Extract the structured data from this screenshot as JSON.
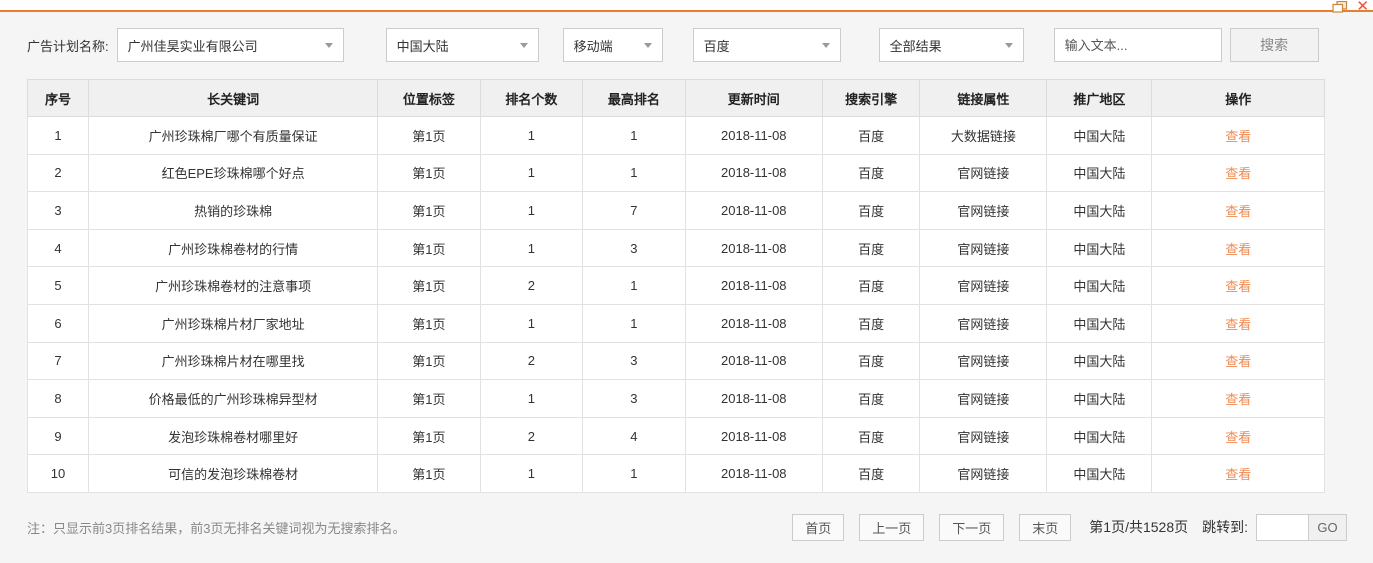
{
  "window": {
    "restore_icon": "restore-window",
    "close_icon": "✕"
  },
  "filters": {
    "label": "广告计划名称:",
    "plan_dropdown": "广州佳昊实业有限公司",
    "region_dropdown": "中国大陆",
    "device_dropdown": "移动端",
    "engine_dropdown": "百度",
    "result_dropdown": "全部结果",
    "search_placeholder": "输入文本...",
    "search_button": "搜索"
  },
  "table": {
    "columns": [
      "序号",
      "长关键词",
      "位置标签",
      "排名个数",
      "最高排名",
      "更新时间",
      "搜索引擎",
      "链接属性",
      "推广地区",
      "操作"
    ],
    "rows": [
      {
        "seq": "1",
        "keyword": "广州珍珠棉厂哪个有质量保证",
        "tag": "第1页",
        "count": "1",
        "best": "1",
        "updated": "2018-11-08",
        "engine": "百度",
        "link_type": "大数据链接",
        "region": "中国大陆",
        "action": "查看"
      },
      {
        "seq": "2",
        "keyword": "红色EPE珍珠棉哪个好点",
        "tag": "第1页",
        "count": "1",
        "best": "1",
        "updated": "2018-11-08",
        "engine": "百度",
        "link_type": "官网链接",
        "region": "中国大陆",
        "action": "查看"
      },
      {
        "seq": "3",
        "keyword": "热销的珍珠棉",
        "tag": "第1页",
        "count": "1",
        "best": "7",
        "updated": "2018-11-08",
        "engine": "百度",
        "link_type": "官网链接",
        "region": "中国大陆",
        "action": "查看"
      },
      {
        "seq": "4",
        "keyword": "广州珍珠棉卷材的行情",
        "tag": "第1页",
        "count": "1",
        "best": "3",
        "updated": "2018-11-08",
        "engine": "百度",
        "link_type": "官网链接",
        "region": "中国大陆",
        "action": "查看"
      },
      {
        "seq": "5",
        "keyword": "广州珍珠棉卷材的注意事项",
        "tag": "第1页",
        "count": "2",
        "best": "1",
        "updated": "2018-11-08",
        "engine": "百度",
        "link_type": "官网链接",
        "region": "中国大陆",
        "action": "查看"
      },
      {
        "seq": "6",
        "keyword": "广州珍珠棉片材厂家地址",
        "tag": "第1页",
        "count": "1",
        "best": "1",
        "updated": "2018-11-08",
        "engine": "百度",
        "link_type": "官网链接",
        "region": "中国大陆",
        "action": "查看"
      },
      {
        "seq": "7",
        "keyword": "广州珍珠棉片材在哪里找",
        "tag": "第1页",
        "count": "2",
        "best": "3",
        "updated": "2018-11-08",
        "engine": "百度",
        "link_type": "官网链接",
        "region": "中国大陆",
        "action": "查看"
      },
      {
        "seq": "8",
        "keyword": "价格最低的广州珍珠棉异型材",
        "tag": "第1页",
        "count": "1",
        "best": "3",
        "updated": "2018-11-08",
        "engine": "百度",
        "link_type": "官网链接",
        "region": "中国大陆",
        "action": "查看"
      },
      {
        "seq": "9",
        "keyword": "发泡珍珠棉卷材哪里好",
        "tag": "第1页",
        "count": "2",
        "best": "4",
        "updated": "2018-11-08",
        "engine": "百度",
        "link_type": "官网链接",
        "region": "中国大陆",
        "action": "查看"
      },
      {
        "seq": "10",
        "keyword": "可信的发泡珍珠棉卷材",
        "tag": "第1页",
        "count": "1",
        "best": "1",
        "updated": "2018-11-08",
        "engine": "百度",
        "link_type": "官网链接",
        "region": "中国大陆",
        "action": "查看"
      }
    ]
  },
  "footer": {
    "note": "注：只显示前3页排名结果，前3页无排名关键词视为无搜索排名。",
    "pagination": {
      "first": "首页",
      "prev": "上一页",
      "next": "下一页",
      "last": "末页",
      "page_info": "第1页/共1528页",
      "jump_label": "跳转到:",
      "jump_value": "",
      "go": "GO"
    }
  },
  "colors": {
    "accent_line": "#e87e2e",
    "view_link": "#ef8b52",
    "close_icon": "#f1503a",
    "header_bg": "#f0f0f0",
    "page_bg": "#f5f5f6"
  }
}
